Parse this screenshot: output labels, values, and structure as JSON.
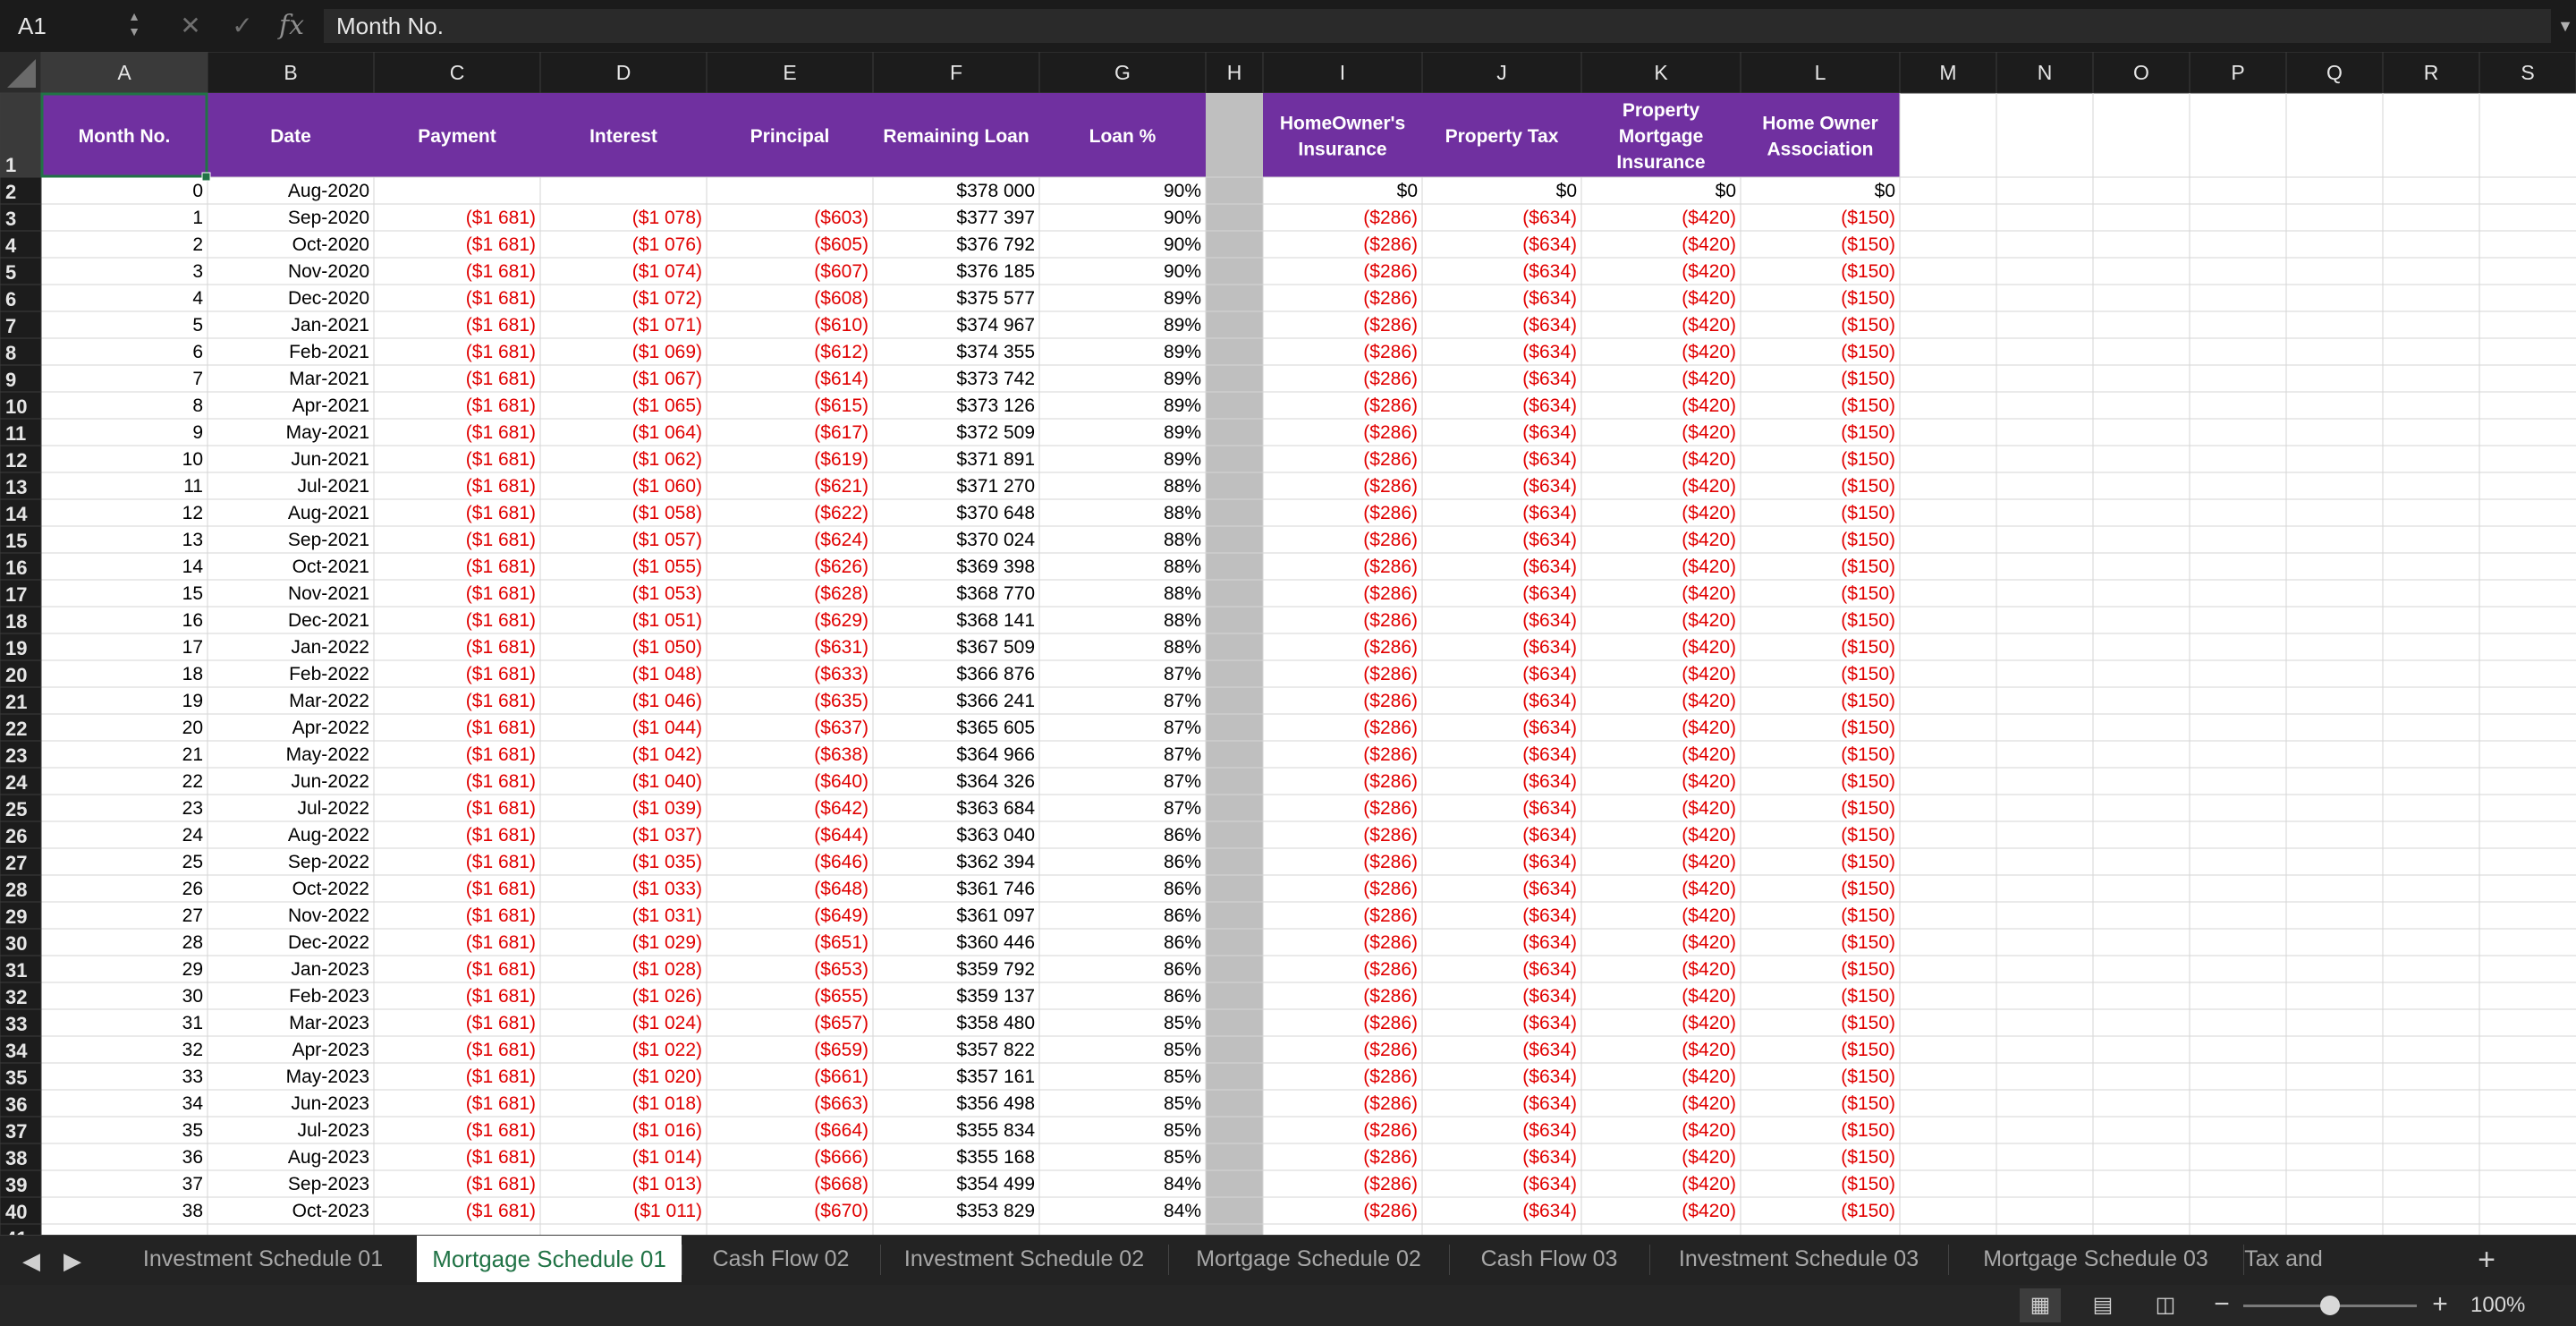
{
  "formula_bar": {
    "name_box": "A1",
    "fx_label": "fx",
    "content": "Month No."
  },
  "columns": [
    "A",
    "B",
    "C",
    "D",
    "E",
    "F",
    "G",
    "H",
    "I",
    "J",
    "K",
    "L",
    "M",
    "N",
    "O",
    "P",
    "Q",
    "R",
    "S"
  ],
  "headers": {
    "A": [
      "Month No."
    ],
    "B": [
      "Date"
    ],
    "C": [
      "Payment"
    ],
    "D": [
      "Interest"
    ],
    "E": [
      "Principal"
    ],
    "F": [
      "Remaining Loan"
    ],
    "G": [
      "Loan %"
    ],
    "I": [
      "HomeOwner's",
      "Insurance"
    ],
    "J": [
      "Property Tax"
    ],
    "K": [
      "Property",
      "Mortgage",
      "Insurance"
    ],
    "L": [
      "Home Owner",
      "Association"
    ]
  },
  "colors": {
    "header_fill": "#7030a0",
    "header_text": "#ffffff",
    "negative": "#e00000",
    "separator_column": "#bfbfbf",
    "selected_border": "#217346"
  },
  "first_row": {
    "month": "0",
    "date": "Aug-2020",
    "payment": "",
    "interest": "",
    "principal": "",
    "remaining": "$378 000",
    "loan_pct": "90%",
    "insurance": "$0",
    "tax": "$0",
    "pmi": "$0",
    "hoa": "$0"
  },
  "recurring": {
    "payment": "($1 681)",
    "insurance": "($286)",
    "tax": "($634)",
    "pmi": "($420)",
    "hoa": "($150)"
  },
  "rows": [
    {
      "month": "1",
      "date": "Sep-2020",
      "interest": "($1 078)",
      "principal": "($603)",
      "remaining": "$377 397",
      "loan_pct": "90%"
    },
    {
      "month": "2",
      "date": "Oct-2020",
      "interest": "($1 076)",
      "principal": "($605)",
      "remaining": "$376 792",
      "loan_pct": "90%"
    },
    {
      "month": "3",
      "date": "Nov-2020",
      "interest": "($1 074)",
      "principal": "($607)",
      "remaining": "$376 185",
      "loan_pct": "90%"
    },
    {
      "month": "4",
      "date": "Dec-2020",
      "interest": "($1 072)",
      "principal": "($608)",
      "remaining": "$375 577",
      "loan_pct": "89%"
    },
    {
      "month": "5",
      "date": "Jan-2021",
      "interest": "($1 071)",
      "principal": "($610)",
      "remaining": "$374 967",
      "loan_pct": "89%"
    },
    {
      "month": "6",
      "date": "Feb-2021",
      "interest": "($1 069)",
      "principal": "($612)",
      "remaining": "$374 355",
      "loan_pct": "89%"
    },
    {
      "month": "7",
      "date": "Mar-2021",
      "interest": "($1 067)",
      "principal": "($614)",
      "remaining": "$373 742",
      "loan_pct": "89%"
    },
    {
      "month": "8",
      "date": "Apr-2021",
      "interest": "($1 065)",
      "principal": "($615)",
      "remaining": "$373 126",
      "loan_pct": "89%"
    },
    {
      "month": "9",
      "date": "May-2021",
      "interest": "($1 064)",
      "principal": "($617)",
      "remaining": "$372 509",
      "loan_pct": "89%"
    },
    {
      "month": "10",
      "date": "Jun-2021",
      "interest": "($1 062)",
      "principal": "($619)",
      "remaining": "$371 891",
      "loan_pct": "89%"
    },
    {
      "month": "11",
      "date": "Jul-2021",
      "interest": "($1 060)",
      "principal": "($621)",
      "remaining": "$371 270",
      "loan_pct": "88%"
    },
    {
      "month": "12",
      "date": "Aug-2021",
      "interest": "($1 058)",
      "principal": "($622)",
      "remaining": "$370 648",
      "loan_pct": "88%"
    },
    {
      "month": "13",
      "date": "Sep-2021",
      "interest": "($1 057)",
      "principal": "($624)",
      "remaining": "$370 024",
      "loan_pct": "88%"
    },
    {
      "month": "14",
      "date": "Oct-2021",
      "interest": "($1 055)",
      "principal": "($626)",
      "remaining": "$369 398",
      "loan_pct": "88%"
    },
    {
      "month": "15",
      "date": "Nov-2021",
      "interest": "($1 053)",
      "principal": "($628)",
      "remaining": "$368 770",
      "loan_pct": "88%"
    },
    {
      "month": "16",
      "date": "Dec-2021",
      "interest": "($1 051)",
      "principal": "($629)",
      "remaining": "$368 141",
      "loan_pct": "88%"
    },
    {
      "month": "17",
      "date": "Jan-2022",
      "interest": "($1 050)",
      "principal": "($631)",
      "remaining": "$367 509",
      "loan_pct": "88%"
    },
    {
      "month": "18",
      "date": "Feb-2022",
      "interest": "($1 048)",
      "principal": "($633)",
      "remaining": "$366 876",
      "loan_pct": "87%"
    },
    {
      "month": "19",
      "date": "Mar-2022",
      "interest": "($1 046)",
      "principal": "($635)",
      "remaining": "$366 241",
      "loan_pct": "87%"
    },
    {
      "month": "20",
      "date": "Apr-2022",
      "interest": "($1 044)",
      "principal": "($637)",
      "remaining": "$365 605",
      "loan_pct": "87%"
    },
    {
      "month": "21",
      "date": "May-2022",
      "interest": "($1 042)",
      "principal": "($638)",
      "remaining": "$364 966",
      "loan_pct": "87%"
    },
    {
      "month": "22",
      "date": "Jun-2022",
      "interest": "($1 040)",
      "principal": "($640)",
      "remaining": "$364 326",
      "loan_pct": "87%"
    },
    {
      "month": "23",
      "date": "Jul-2022",
      "interest": "($1 039)",
      "principal": "($642)",
      "remaining": "$363 684",
      "loan_pct": "87%"
    },
    {
      "month": "24",
      "date": "Aug-2022",
      "interest": "($1 037)",
      "principal": "($644)",
      "remaining": "$363 040",
      "loan_pct": "86%"
    },
    {
      "month": "25",
      "date": "Sep-2022",
      "interest": "($1 035)",
      "principal": "($646)",
      "remaining": "$362 394",
      "loan_pct": "86%"
    },
    {
      "month": "26",
      "date": "Oct-2022",
      "interest": "($1 033)",
      "principal": "($648)",
      "remaining": "$361 746",
      "loan_pct": "86%"
    },
    {
      "month": "27",
      "date": "Nov-2022",
      "interest": "($1 031)",
      "principal": "($649)",
      "remaining": "$361 097",
      "loan_pct": "86%"
    },
    {
      "month": "28",
      "date": "Dec-2022",
      "interest": "($1 029)",
      "principal": "($651)",
      "remaining": "$360 446",
      "loan_pct": "86%"
    },
    {
      "month": "29",
      "date": "Jan-2023",
      "interest": "($1 028)",
      "principal": "($653)",
      "remaining": "$359 792",
      "loan_pct": "86%"
    },
    {
      "month": "30",
      "date": "Feb-2023",
      "interest": "($1 026)",
      "principal": "($655)",
      "remaining": "$359 137",
      "loan_pct": "86%"
    },
    {
      "month": "31",
      "date": "Mar-2023",
      "interest": "($1 024)",
      "principal": "($657)",
      "remaining": "$358 480",
      "loan_pct": "85%"
    },
    {
      "month": "32",
      "date": "Apr-2023",
      "interest": "($1 022)",
      "principal": "($659)",
      "remaining": "$357 822",
      "loan_pct": "85%"
    },
    {
      "month": "33",
      "date": "May-2023",
      "interest": "($1 020)",
      "principal": "($661)",
      "remaining": "$357 161",
      "loan_pct": "85%"
    },
    {
      "month": "34",
      "date": "Jun-2023",
      "interest": "($1 018)",
      "principal": "($663)",
      "remaining": "$356 498",
      "loan_pct": "85%"
    },
    {
      "month": "35",
      "date": "Jul-2023",
      "interest": "($1 016)",
      "principal": "($664)",
      "remaining": "$355 834",
      "loan_pct": "85%"
    },
    {
      "month": "36",
      "date": "Aug-2023",
      "interest": "($1 014)",
      "principal": "($666)",
      "remaining": "$355 168",
      "loan_pct": "85%"
    },
    {
      "month": "37",
      "date": "Sep-2023",
      "interest": "($1 013)",
      "principal": "($668)",
      "remaining": "$354 499",
      "loan_pct": "84%"
    },
    {
      "month": "38",
      "date": "Oct-2023",
      "interest": "($1 011)",
      "principal": "($670)",
      "remaining": "$353 829",
      "loan_pct": "84%"
    }
  ],
  "sheet_tabs": [
    {
      "label": "Investment Schedule 01",
      "active": false
    },
    {
      "label": "Mortgage Schedule 01",
      "active": true
    },
    {
      "label": "Cash Flow 02",
      "active": false
    },
    {
      "label": "Investment Schedule 02",
      "active": false
    },
    {
      "label": "Mortgage Schedule 02",
      "active": false
    },
    {
      "label": "Cash Flow 03",
      "active": false
    },
    {
      "label": "Investment Schedule 03",
      "active": false
    },
    {
      "label": "Mortgage Schedule 03",
      "active": false
    },
    {
      "label": "Tax and",
      "active": false
    }
  ],
  "status": {
    "view_icons": [
      "normal-view-icon",
      "page-layout-view-icon",
      "page-break-view-icon"
    ],
    "zoom_level": "100%",
    "zoom_fraction": 0.5
  }
}
